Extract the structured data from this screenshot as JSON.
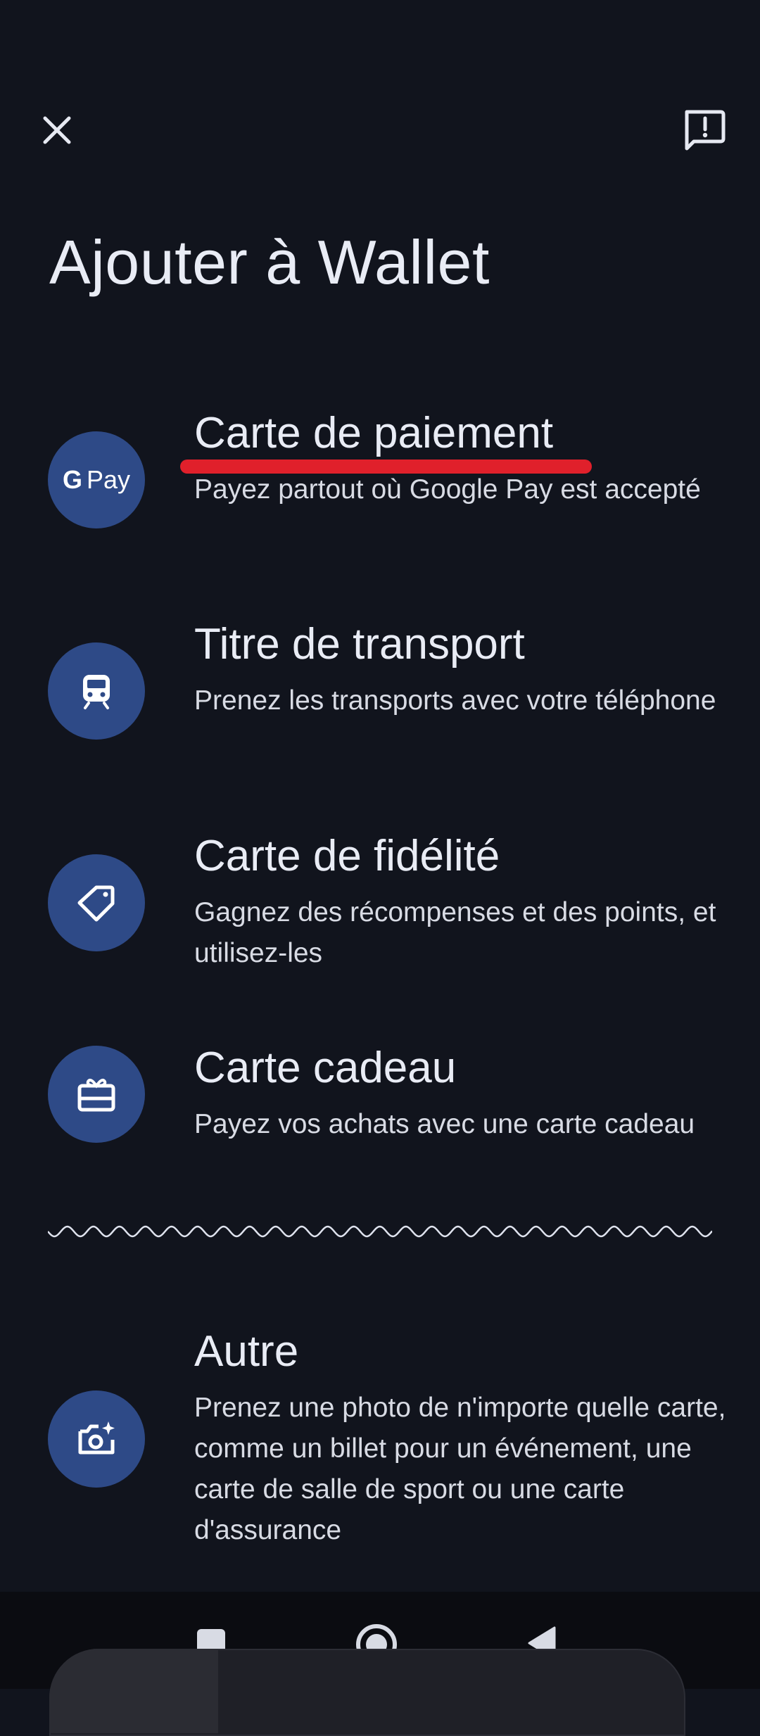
{
  "header": {
    "title": "Ajouter à Wallet"
  },
  "items": [
    {
      "label": "Carte de paiement",
      "description": "Payez partout où Google Pay est accepté",
      "icon": "google-pay-icon"
    },
    {
      "label": "Titre de transport",
      "description": "Prenez les transports avec votre téléphone",
      "icon": "train-icon"
    },
    {
      "label": "Carte de fidélité",
      "description": "Gagnez des récompenses et des points, et utilisez-les",
      "icon": "loyalty-tag-icon"
    },
    {
      "label": "Carte cadeau",
      "description": "Payez vos achats avec une carte cadeau",
      "icon": "gift-card-icon"
    },
    {
      "label": "Autre",
      "description": "Prenez une photo de n'importe quelle carte, comme un billet pour un événement, une carte de salle de sport ou une carte d'assurance",
      "icon": "camera-sparkle-icon"
    }
  ],
  "gpay": {
    "g": "G",
    "pay": "Pay"
  },
  "colors": {
    "background": "#11141d",
    "icon_circle": "#2e4a87",
    "annotation_underline": "#e0202b",
    "navbar": "#0b0c11"
  }
}
